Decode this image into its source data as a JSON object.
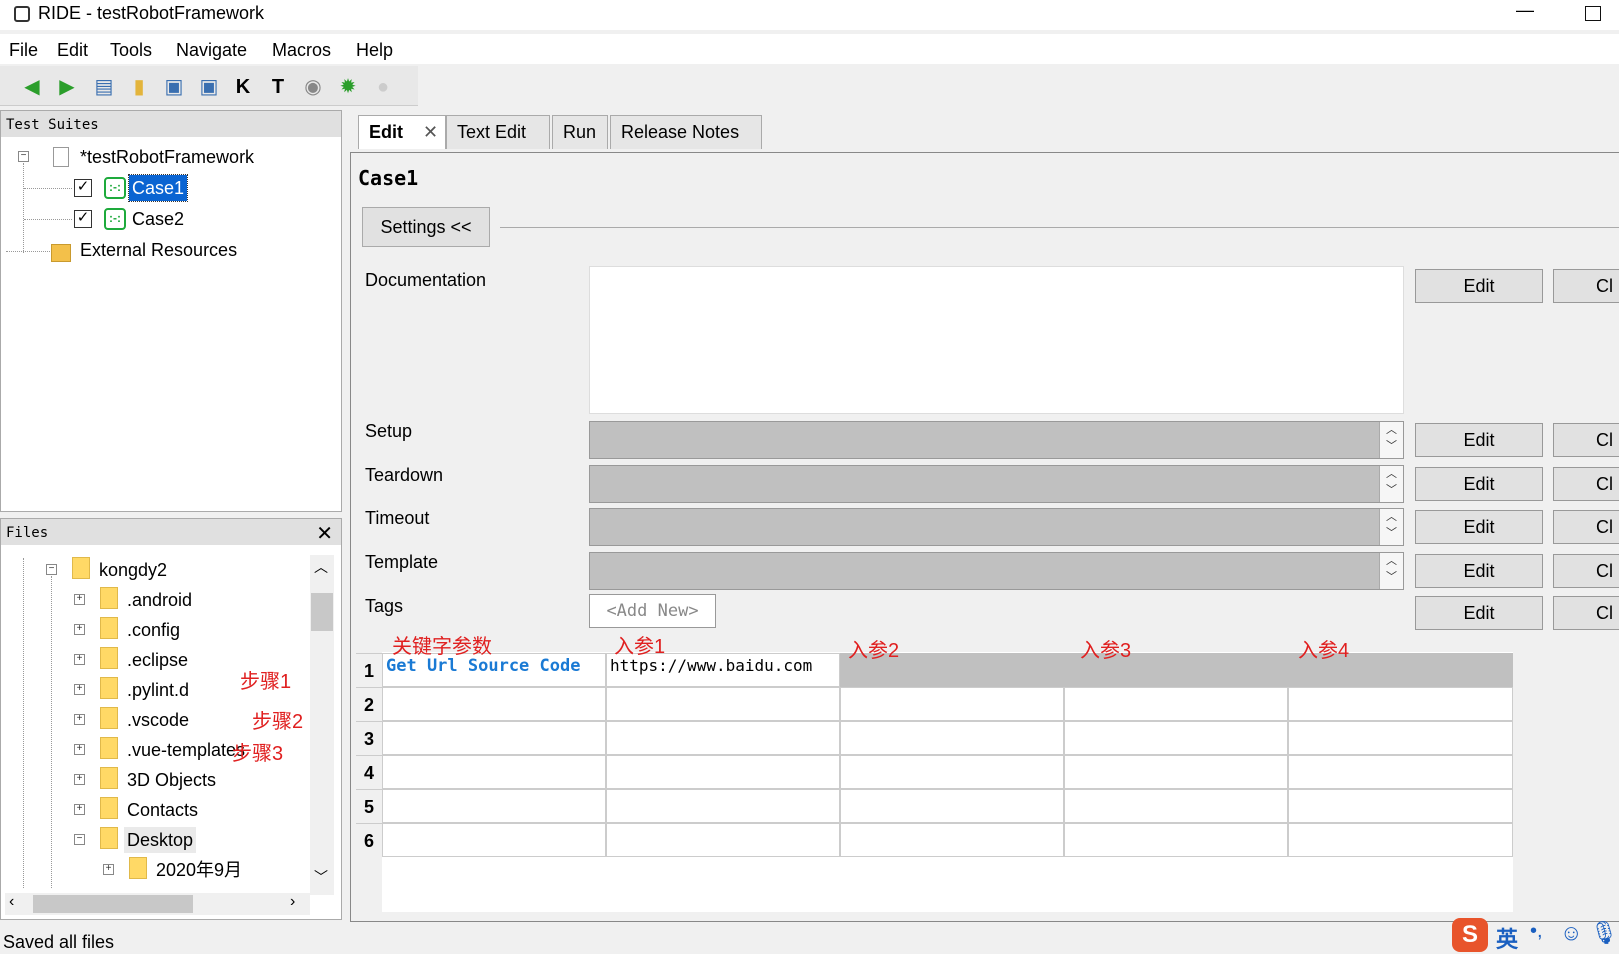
{
  "window": {
    "title": "RIDE - testRobotFramework"
  },
  "menu": [
    "File",
    "Edit",
    "Tools",
    "Navigate",
    "Macros",
    "Help"
  ],
  "toolbar": {
    "icons": [
      "back-arrow-icon",
      "forward-arrow-icon",
      "open-icon",
      "open-directory-icon",
      "save-icon",
      "save-all-icon",
      "keyword-search-icon",
      "test-search-icon",
      "run-icon",
      "debug-icon",
      "stop-icon"
    ]
  },
  "test_suites": {
    "header": "Test Suites",
    "root": "*testRobotFramework",
    "cases": [
      "Case1",
      "Case2"
    ],
    "external": "External Resources"
  },
  "files": {
    "header": "Files",
    "items": [
      {
        "name": "kongdy2",
        "expanded": true
      },
      {
        "name": ".android",
        "expanded": false
      },
      {
        "name": ".config",
        "expanded": false
      },
      {
        "name": ".eclipse",
        "expanded": false
      },
      {
        "name": ".pylint.d",
        "expanded": false
      },
      {
        "name": ".vscode",
        "expanded": false
      },
      {
        "name": ".vue-templates",
        "expanded": false
      },
      {
        "name": "3D Objects",
        "expanded": false
      },
      {
        "name": "Contacts",
        "expanded": false
      },
      {
        "name": "Desktop",
        "expanded": true
      },
      {
        "name": "2020年9月",
        "expanded": false
      }
    ]
  },
  "annotations": {
    "step1": "步骤1",
    "step2": "步骤2",
    "step3": "步骤3",
    "keyword_param": "关键字参数",
    "arg1": "入参1",
    "arg2": "入参2",
    "arg3": "入参3",
    "arg4": "入参4"
  },
  "tabs": [
    "Edit",
    "Text Edit",
    "Run",
    "Release Notes"
  ],
  "editor": {
    "case_name": "Case1",
    "settings_label": "Settings <<",
    "fields": {
      "documentation": "Documentation",
      "setup": "Setup",
      "teardown": "Teardown",
      "timeout": "Timeout",
      "template": "Template",
      "tags": "Tags"
    },
    "edit_label": "Edit",
    "clear_label": "Cl",
    "tags_placeholder": "<Add New>"
  },
  "grid": {
    "rows": [
      "1",
      "2",
      "3",
      "4",
      "5",
      "6"
    ],
    "row1": {
      "keyword": "Get Url Source Code",
      "arg1": "https://www.baidu.com"
    }
  },
  "status": {
    "text": "Saved all files"
  },
  "ime": {
    "lang": "英"
  }
}
